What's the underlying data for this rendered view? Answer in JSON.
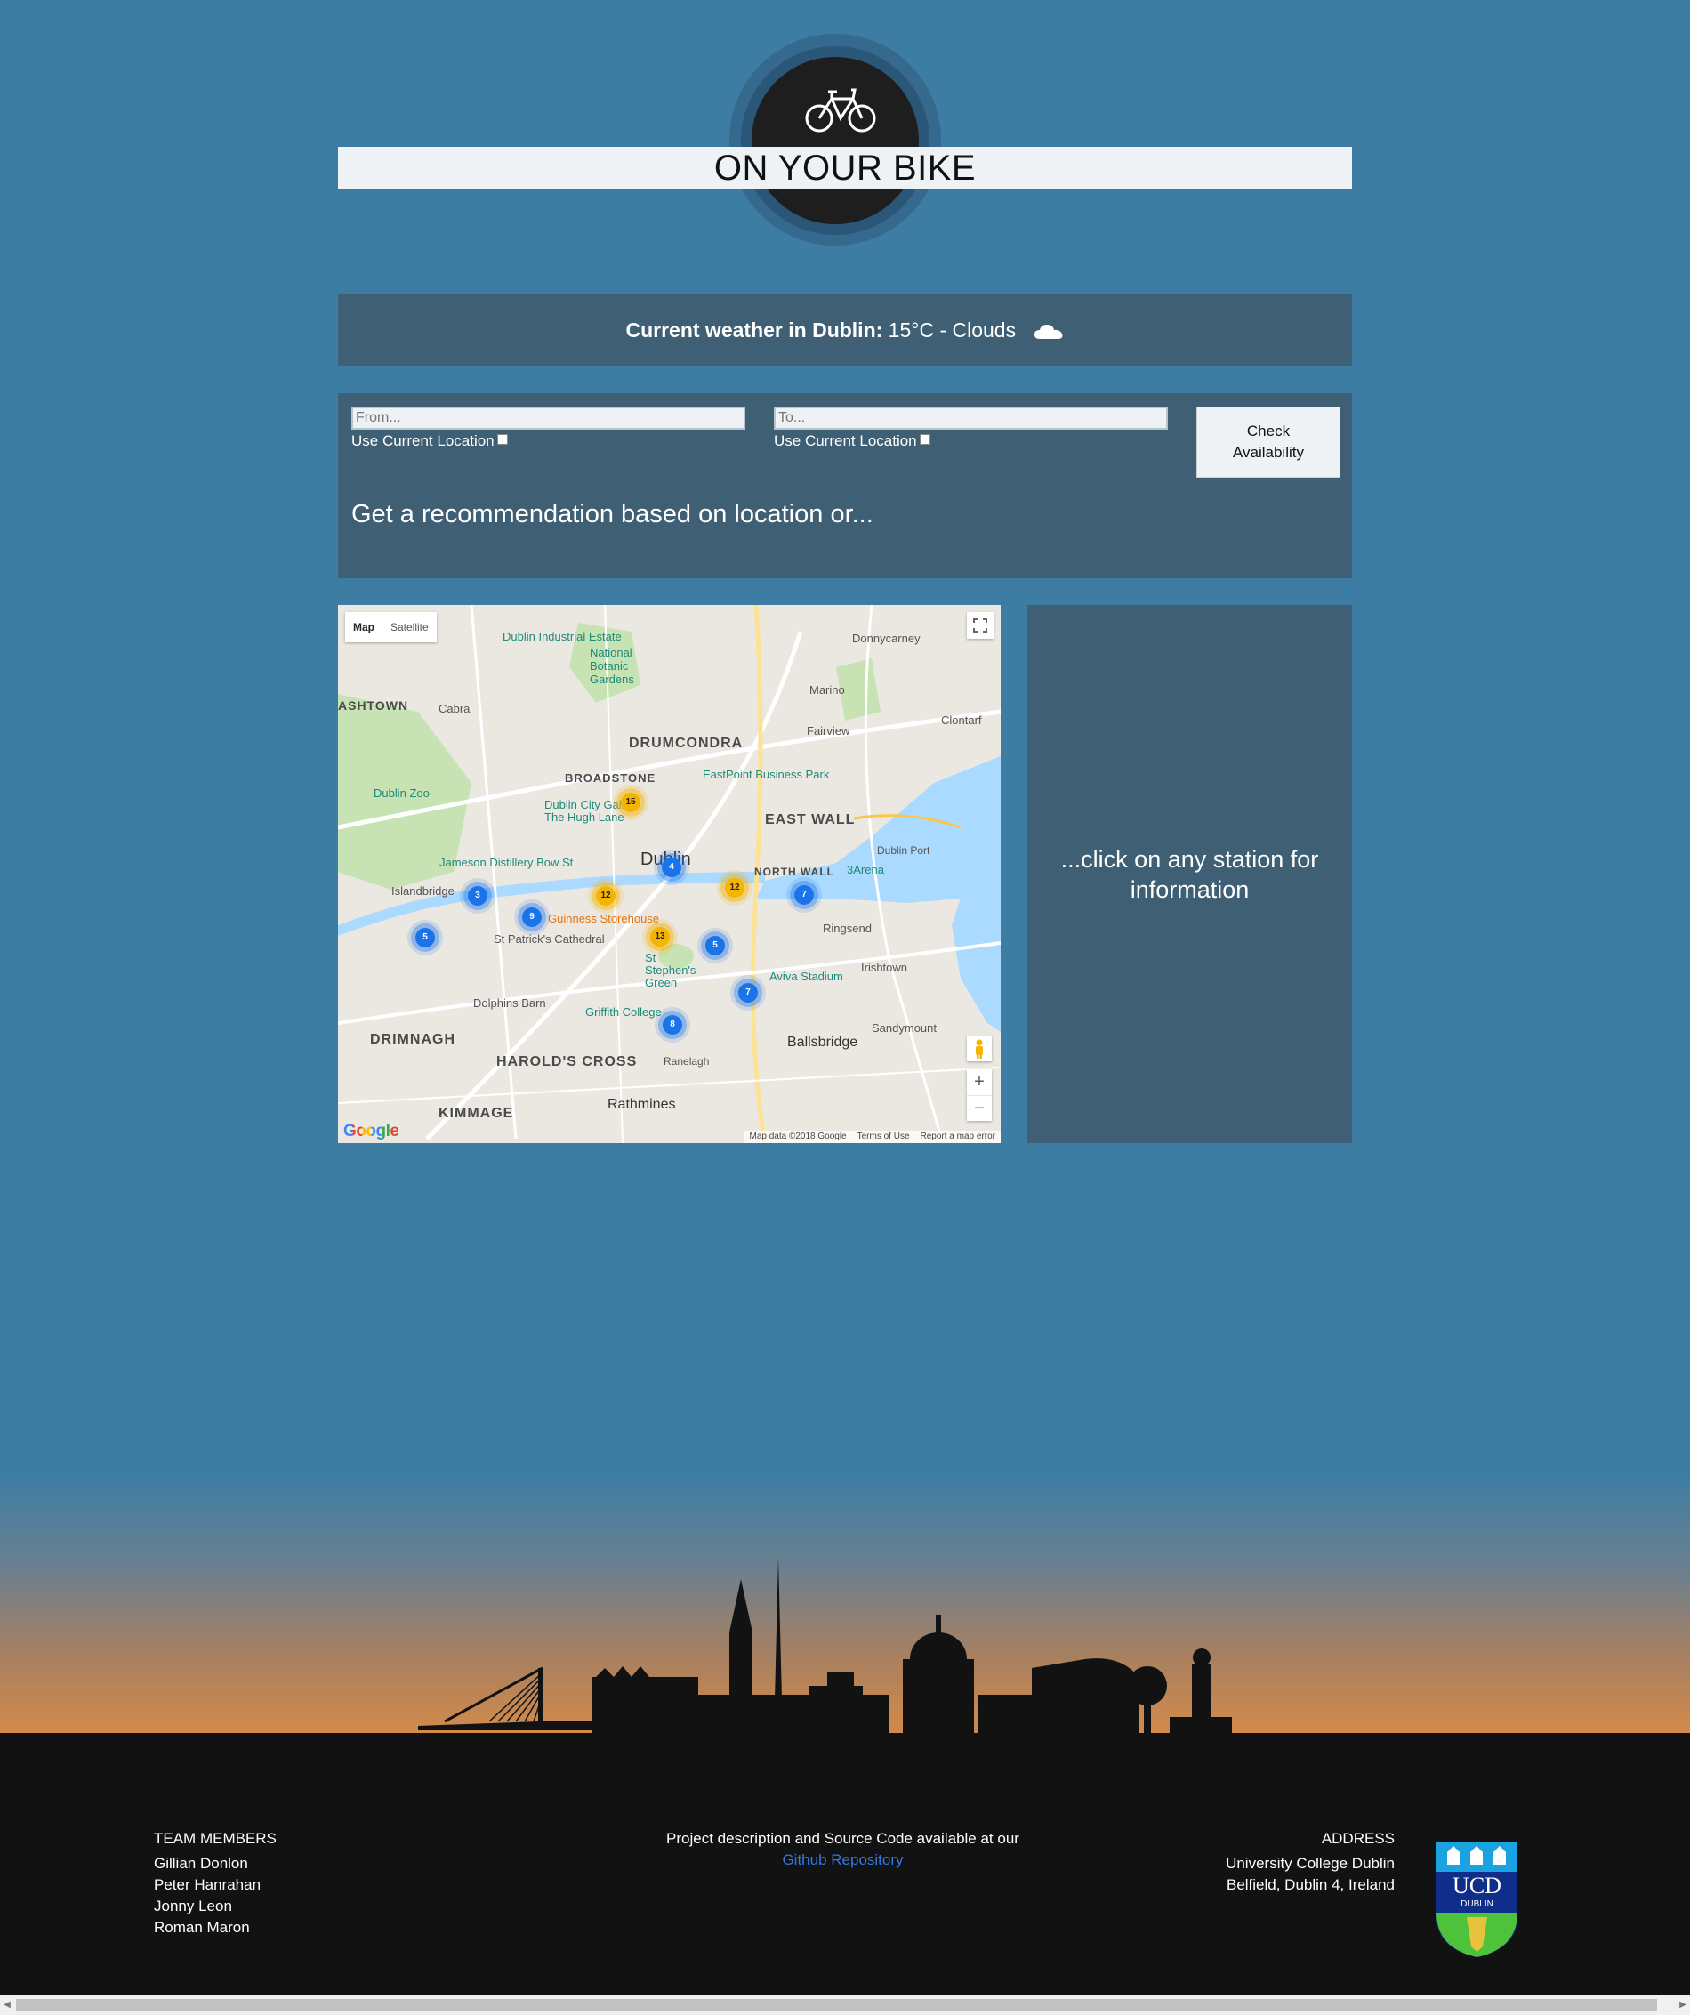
{
  "header": {
    "title": "ON YOUR BIKE"
  },
  "weather": {
    "label": "Current weather in Dublin:",
    "value": "15°C - Clouds",
    "icon": "cloud-icon"
  },
  "form": {
    "from_placeholder": "From...",
    "to_placeholder": "To...",
    "from_use_location": "Use Current Location",
    "to_use_location": "Use Current Location",
    "check_button": "Check Availability",
    "recommendation": "Get a recommendation based on location or..."
  },
  "map": {
    "tab_map": "Map",
    "tab_satellite": "Satellite",
    "zoom_in": "+",
    "zoom_out": "−",
    "logo": "Google",
    "footer_data": "Map data ©2018 Google",
    "footer_terms": "Terms of Use",
    "footer_report": "Report a map error",
    "labels": {
      "drumcondra": "DRUMCONDRA",
      "broadstone": "BROADSTONE",
      "east_wall": "EAST WALL",
      "north_wall": "NORTH WALL",
      "dublin": "Dublin",
      "drimnagh": "DRIMNAGH",
      "harolds_cross": "HAROLD'S CROSS",
      "kimmage": "KIMMAGE",
      "rathmines": "Rathmines",
      "ballsbridge": "Ballsbridge",
      "ringsend": "Ringsend",
      "irishtown": "Irishtown",
      "sandymount": "Sandymount",
      "marino": "Marino",
      "fairview": "Fairview",
      "clontarf": "Clontarf",
      "donnycarney": "Donnycarney",
      "cabra": "Cabra",
      "ashtown": "ASHTOWN",
      "islandbridge": "Islandbridge",
      "dolphins_barn": "Dolphins Barn",
      "ranelagh": "Ranelagh",
      "dublin_zoo": "Dublin Zoo",
      "botanic_gardens": "National Botanic Gardens",
      "industrial_estate": "Dublin Industrial Estate",
      "eastpoint": "EastPoint Business Park",
      "dublin_port": "Dublin Port",
      "three_arena": "3Arena",
      "jameson": "Jameson Distillery Bow St",
      "guinness": "Guinness Storehouse",
      "st_patricks": "St Patrick's Cathedral",
      "st_stephens": "St Stephen's Green",
      "aviva": "Aviva Stadium",
      "griffith": "Griffith College",
      "hugh_lane": "Dublin City Gallery The Hugh Lane"
    },
    "clusters": [
      {
        "count": "15",
        "color": "yellow"
      },
      {
        "count": "4",
        "color": "blue"
      },
      {
        "count": "12",
        "color": "yellow"
      },
      {
        "count": "12",
        "color": "yellow"
      },
      {
        "count": "7",
        "color": "blue"
      },
      {
        "count": "3",
        "color": "blue"
      },
      {
        "count": "9",
        "color": "blue"
      },
      {
        "count": "5",
        "color": "blue"
      },
      {
        "count": "13",
        "color": "yellow"
      },
      {
        "count": "5",
        "color": "blue"
      },
      {
        "count": "7",
        "color": "blue"
      },
      {
        "count": "8",
        "color": "blue"
      }
    ]
  },
  "info_panel": {
    "text": "...click on any station for information"
  },
  "footer": {
    "team_heading": "TEAM MEMBERS",
    "team": [
      "Gillian Donlon",
      "Peter Hanrahan",
      "Jonny Leon",
      "Roman Maron"
    ],
    "project_text": "Project description and Source Code available at our",
    "repo_link": "Github Repository",
    "address_heading": "ADDRESS",
    "address_line1": "University College Dublin",
    "address_line2": "Belfield, Dublin 4, Ireland",
    "logo_text_top": "UCD",
    "logo_text_bottom": "DUBLIN"
  }
}
